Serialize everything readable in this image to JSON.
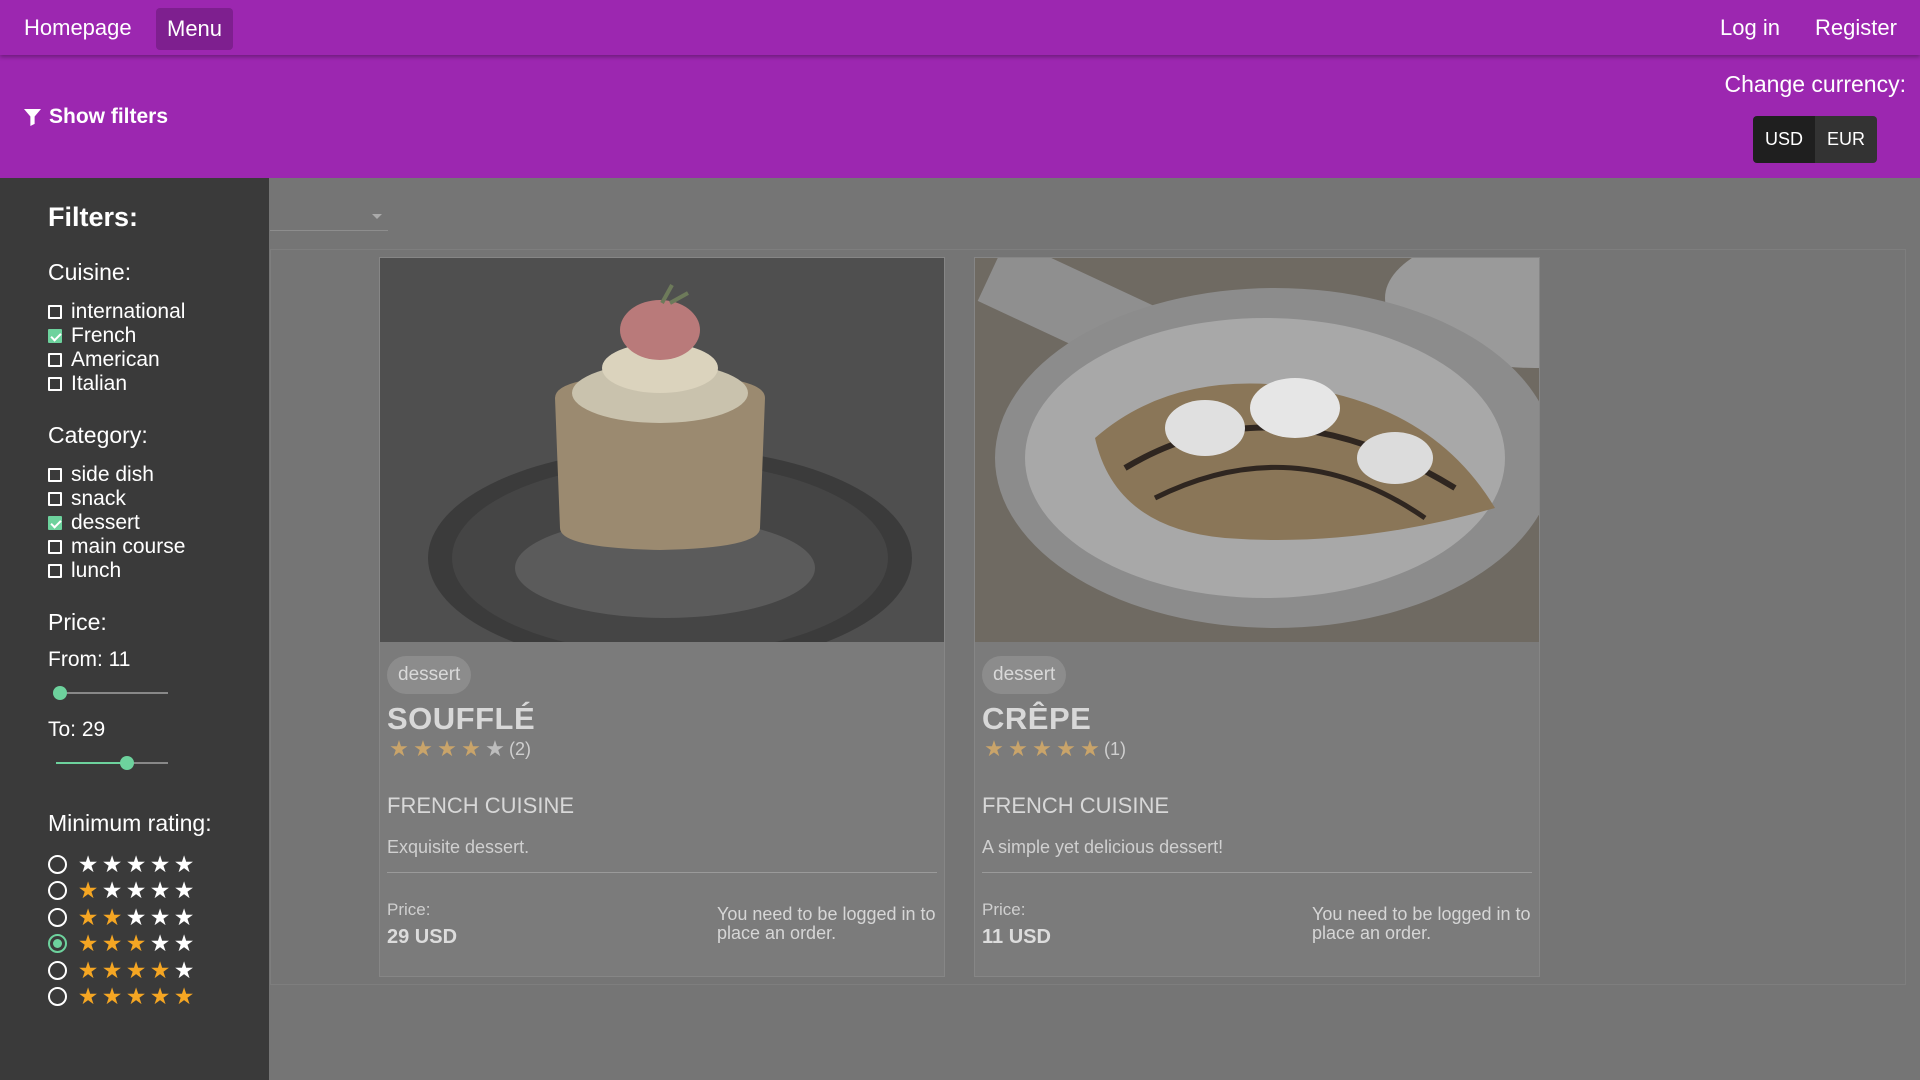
{
  "nav": {
    "home": "Homepage",
    "menu": "Menu",
    "login": "Log in",
    "register": "Register"
  },
  "filterbar": {
    "show_filters": "Show filters",
    "filter_icon": "filter-icon",
    "currency_label": "Change currency:",
    "currencies": [
      "USD",
      "EUR"
    ],
    "selected_currency": "USD"
  },
  "sidebar": {
    "title": "Filters:",
    "cuisine_label": "Cuisine:",
    "cuisines": [
      {
        "label": "international",
        "checked": false
      },
      {
        "label": "French",
        "checked": true
      },
      {
        "label": "American",
        "checked": false
      },
      {
        "label": "Italian",
        "checked": false
      }
    ],
    "category_label": "Category:",
    "categories": [
      {
        "label": "side dish",
        "checked": false
      },
      {
        "label": "snack",
        "checked": false
      },
      {
        "label": "dessert",
        "checked": true
      },
      {
        "label": "main course",
        "checked": false
      },
      {
        "label": "lunch",
        "checked": false
      }
    ],
    "price_label": "Price:",
    "from_label": "From: 11",
    "to_label": "To: 29",
    "from_fraction": 0.04,
    "to_fraction": 0.63,
    "min_rating_label": "Minimum rating:",
    "rating_options": [
      0,
      1,
      2,
      3,
      4,
      5
    ],
    "selected_rating": 3,
    "colors": {
      "accent": "#6dd29d",
      "star": "#f5a623"
    }
  },
  "cards": [
    {
      "tag": "dessert",
      "name": "SOUFFLÉ",
      "rating": 4,
      "rating_count": "(2)",
      "cuisine": "FRENCH CUISINE",
      "description": "Exquisite dessert.",
      "price_label": "Price:",
      "price": "29 USD",
      "login_msg": "You need to be logged in to place an order."
    },
    {
      "tag": "dessert",
      "name": "CRÊPE",
      "rating": 5,
      "rating_count": "(1)",
      "cuisine": "FRENCH CUISINE",
      "description": "A simple yet delicious dessert!",
      "price_label": "Price:",
      "price": "11 USD",
      "login_msg": "You need to be logged in to place an order."
    }
  ],
  "colors": {
    "brand": "#9c27b0",
    "overlay": "#757575"
  }
}
